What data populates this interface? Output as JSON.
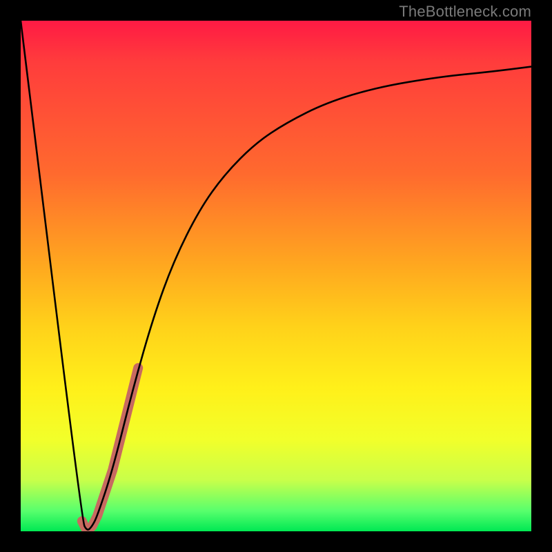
{
  "attribution": "TheBottleneck.com",
  "chart_data": {
    "type": "line",
    "title": "",
    "xlabel": "",
    "ylabel": "",
    "xlim": [
      0,
      100
    ],
    "ylim": [
      0,
      100
    ],
    "series": [
      {
        "name": "main-curve",
        "x": [
          0,
          12,
          13,
          14,
          15,
          18,
          22,
          26,
          30,
          35,
          40,
          46,
          52,
          60,
          70,
          82,
          92,
          100
        ],
        "y": [
          100,
          2,
          0,
          1,
          3,
          12,
          28,
          42,
          53,
          63,
          70,
          76,
          80,
          84,
          87,
          89,
          90,
          91
        ]
      },
      {
        "name": "highlight-segment",
        "x": [
          12,
          13,
          14,
          15,
          16,
          17,
          18,
          19,
          20,
          21,
          22,
          23
        ],
        "y": [
          2,
          0,
          1,
          3,
          6,
          9,
          12,
          16,
          20,
          24,
          28,
          32
        ]
      }
    ],
    "styles": {
      "main-curve": {
        "stroke": "#000000",
        "width": 2.6
      },
      "highlight-segment": {
        "stroke": "#c76a60",
        "width": 14,
        "linecap": "round"
      }
    },
    "gradient_stops": [
      {
        "pos": 0,
        "color": "#ff1a44"
      },
      {
        "pos": 50,
        "color": "#ffc81a"
      },
      {
        "pos": 85,
        "color": "#e8ff3a"
      },
      {
        "pos": 100,
        "color": "#00e853"
      }
    ]
  }
}
